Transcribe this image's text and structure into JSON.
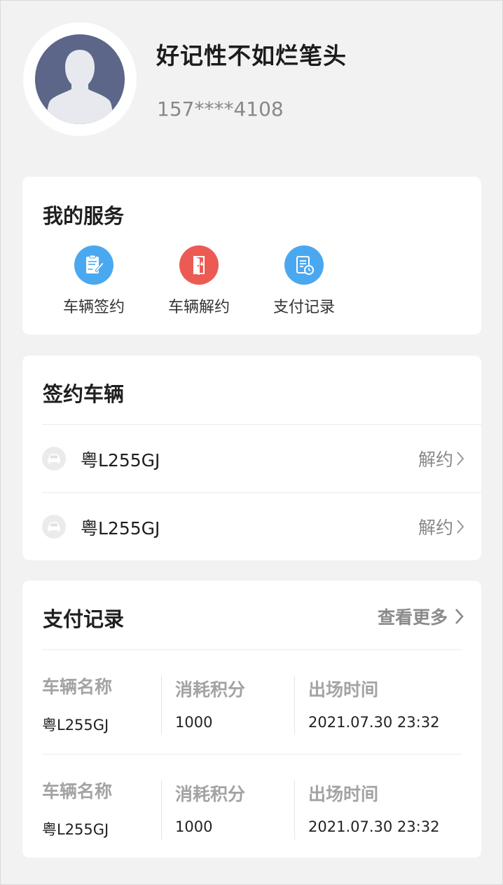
{
  "profile": {
    "name": "好记性不如烂笔头",
    "phone": "157****4108"
  },
  "services": {
    "title": "我的服务",
    "items": [
      {
        "label": "车辆签约",
        "icon": "sign-contract-icon",
        "color": "#4aa8f1"
      },
      {
        "label": "车辆解约",
        "icon": "exit-door-icon",
        "color": "#eb5b54"
      },
      {
        "label": "支付记录",
        "icon": "payment-record-icon",
        "color": "#4aa8f1"
      }
    ]
  },
  "vehicles": {
    "title": "签约车辆",
    "items": [
      {
        "plate": "粤L255GJ",
        "action": "解约"
      },
      {
        "plate": "粤L255GJ",
        "action": "解约"
      }
    ]
  },
  "payments": {
    "title": "支付记录",
    "more": "查看更多",
    "records": [
      {
        "name_header": "车辆名称",
        "name": "粤L255GJ",
        "points_header": "消耗积分",
        "points": "1000",
        "time_header": "出场时间",
        "time": "2021.07.30 23:32"
      },
      {
        "name_header": "车辆名称",
        "name": "粤L255GJ",
        "points_header": "消耗积分",
        "points": "1000",
        "time_header": "出场时间",
        "time": "2021.07.30 23:32"
      }
    ]
  }
}
